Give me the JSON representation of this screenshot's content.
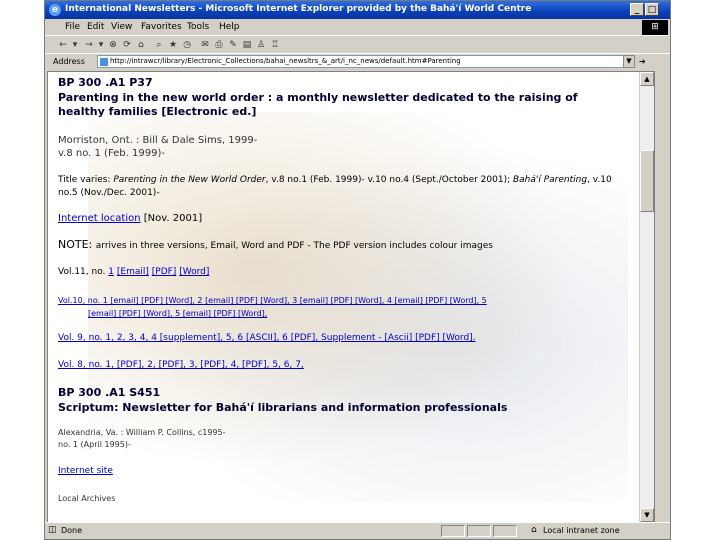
{
  "window": {
    "title": "International Newsletters - Microsoft Internet Explorer provided by the Bahá'í World Centre"
  },
  "menu": {
    "items": [
      "File",
      "Edit",
      "View",
      "Favorites",
      "Tools",
      "Help"
    ]
  },
  "address": {
    "label": "Address",
    "value": "http://intrawcr/library/Electronic_Collections/bahai_newsltrs_&_art/i_nc_news/default.htm#Parenting"
  },
  "record1": {
    "call": "BP 300 .A1 P37",
    "title": "Parenting in the new world order : a monthly newsletter dedicated to the raising of healthy families [Electronic ed.]",
    "imprint1": "Morriston, Ont. : Bill & Dale Sims, 1999-",
    "imprint2": "v.8 no. 1 (Feb. 1999)-",
    "varies_lead": "Title varies: ",
    "varies_t1": "Parenting in the New World Order",
    "varies_mid": ", v.8 no.1 (Feb. 1999)- v.10 no.4 (Sept./October 2001); ",
    "varies_t2": "Bahá'í Parenting",
    "varies_end": ", v.10 no.5 (Nov./Dec. 2001)-",
    "location_link": "Internet location",
    "location_date": " [Nov. 2001]",
    "note_lead": "NOTE: ",
    "note_text": "arrives in three versions, Email, Word and PDF - The PDF version includes colour images"
  },
  "vol11": {
    "label": "Vol.11, no. ",
    "num": "1",
    "links": [
      "[Email]",
      "[PDF]",
      "[Word]"
    ]
  },
  "vol10": {
    "line1": "Vol.10, no. 1 [email] [PDF] [Word], 2 [email] [PDF] [Word], 3 [email] [PDF] [Word], 4 [email] [PDF] [Word], 5",
    "line2": "[email] [PDF] [Word], 5 [email] [PDF] [Word],"
  },
  "vol9": {
    "line": "Vol. 9, no. 1, 2, 3, 4, 4 [supplement], 5, 6 [ASCII], 6 [PDF], Supplement - [Ascii] [PDF] [Word]."
  },
  "vol8": {
    "line": "Vol. 8, no. 1, [PDF], 2, [PDF], 3, [PDF], 4, [PDF], 5, 6, 7,"
  },
  "record2": {
    "call": "BP 300 .A1 S451",
    "title": "Scriptum: Newsletter for Bahá'í librarians and information professionals",
    "imprint1": "Alexandria, Va. : William P. Collins, c1995-",
    "imprint2": "no. 1 (April 1995)-",
    "site_link": "Internet site",
    "archives": "Local Archives"
  },
  "status": {
    "left": "Done",
    "zone": "Local intranet zone"
  }
}
